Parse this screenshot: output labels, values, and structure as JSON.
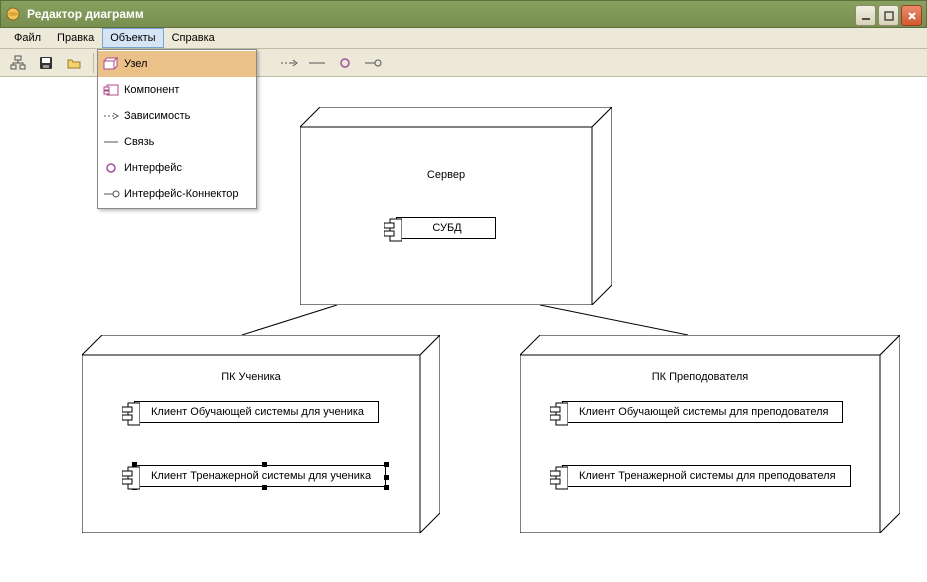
{
  "window": {
    "title": "Редактор диаграмм"
  },
  "menu": {
    "file": "Файл",
    "edit": "Правка",
    "objects": "Объекты",
    "help": "Справка"
  },
  "objects_menu": {
    "node": "Узел",
    "component": "Компонент",
    "dependency": "Зависимость",
    "link": "Связь",
    "interface": "Интерфейс",
    "interface_connector": "Интерфейс-Коннектор"
  },
  "diagram": {
    "server": {
      "title": "Сервер",
      "db": "СУБД"
    },
    "student_pc": {
      "title": "ПК Ученика",
      "client_learn": "Клиент Обучающей системы для ученика",
      "client_train": "Клиент Тренажерной системы для ученика"
    },
    "teacher_pc": {
      "title": "ПК Преподователя",
      "client_learn": "Клиент Обучающей системы для преподователя",
      "client_train": "Клиент Тренажерной системы для преподователя"
    }
  }
}
